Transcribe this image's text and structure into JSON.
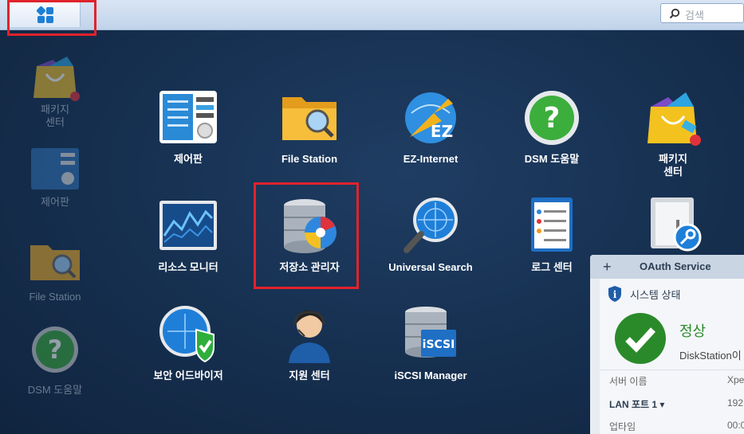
{
  "topbar": {
    "search_placeholder": "검색"
  },
  "desktop": [
    {
      "label": "패키지\n센터",
      "icon": "package-center-icon"
    },
    {
      "label": "제어판",
      "icon": "control-panel-icon"
    },
    {
      "label": "File Station",
      "icon": "file-station-icon"
    },
    {
      "label": "DSM 도움말",
      "icon": "help-icon"
    }
  ],
  "apps": [
    {
      "label": "제어판",
      "icon": "control-panel-icon"
    },
    {
      "label": "File Station",
      "icon": "file-station-icon"
    },
    {
      "label": "EZ-Internet",
      "icon": "ez-internet-icon"
    },
    {
      "label": "DSM 도움말",
      "icon": "help-icon"
    },
    {
      "label": "패키지\n센터",
      "icon": "package-center-icon"
    },
    {
      "label": "리소스 모니터",
      "icon": "resource-monitor-icon"
    },
    {
      "label": "저장소 관리자",
      "icon": "storage-manager-icon"
    },
    {
      "label": "Universal Search",
      "icon": "universal-search-icon"
    },
    {
      "label": "로그 센터",
      "icon": "log-center-icon"
    },
    {
      "label": "",
      "icon": "secure-signin-icon"
    },
    {
      "label": "보안 어드바이저",
      "icon": "security-advisor-icon"
    },
    {
      "label": "지원 센터",
      "icon": "support-center-icon"
    },
    {
      "label": "iSCSI Manager",
      "icon": "iscsi-manager-icon"
    }
  ],
  "widget": {
    "add_symbol": "+",
    "title": "OAuth Service",
    "section_title": "시스템 상태",
    "status": "정상",
    "device": "DiskStation이",
    "rows": [
      {
        "label": "서버 이름",
        "value": "Xpe"
      },
      {
        "label": "LAN 포트 1 ▾",
        "value": "192"
      },
      {
        "label": "업타임",
        "value": "00:0"
      }
    ]
  }
}
